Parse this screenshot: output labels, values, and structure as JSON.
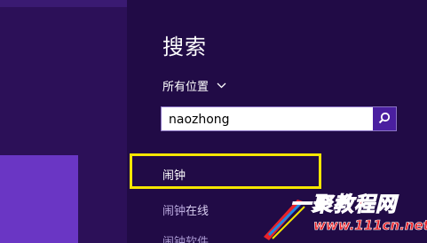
{
  "search_pane": {
    "title": "搜索",
    "scope_label": "所有位置",
    "scope_icon": "chevron-down-icon",
    "query": "naozhong",
    "search_button_icon": "search-icon"
  },
  "results": [
    {
      "match": "闹钟",
      "rest": ""
    },
    {
      "match": "闹钟",
      "rest": "在线"
    },
    {
      "match": "闹钟",
      "rest": "软件"
    }
  ],
  "colors": {
    "background": "#2a0f55",
    "pane": "#210b46",
    "tile": "#6a36c4",
    "accent": "#4a1fa0",
    "highlight": "#f5e600"
  },
  "watermark": {
    "brand": "一聚教程网",
    "site": "www.111cn.net"
  }
}
